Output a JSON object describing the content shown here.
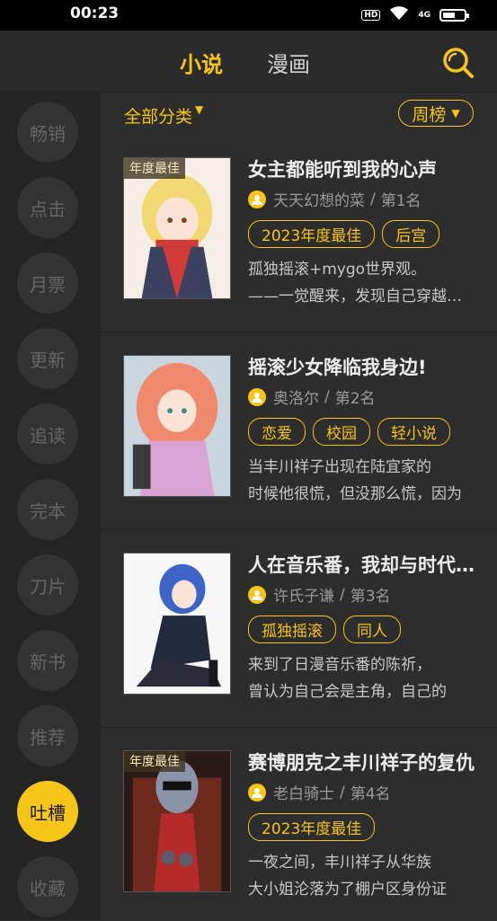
{
  "status_bar": {
    "time": "00:23",
    "hd": "HD",
    "network": "4G",
    "battery_level": 0.6
  },
  "header": {
    "tabs": [
      {
        "label": "小说",
        "active": true
      },
      {
        "label": "漫画",
        "active": false
      }
    ],
    "search_icon": "search-icon"
  },
  "sidebar": {
    "items": [
      {
        "label": "畅销"
      },
      {
        "label": "点击"
      },
      {
        "label": "月票"
      },
      {
        "label": "更新"
      },
      {
        "label": "追读"
      },
      {
        "label": "完本"
      },
      {
        "label": "刀片"
      },
      {
        "label": "新书"
      },
      {
        "label": "推荐"
      },
      {
        "label": "吐槽",
        "active": true
      },
      {
        "label": "收藏"
      }
    ]
  },
  "filter": {
    "category_label": "全部分类",
    "rank_label": "周榜"
  },
  "books": [
    {
      "badge": "年度最佳",
      "title": "女主都能听到我的心声",
      "author": "天天幻想的菜",
      "rank": "第1名",
      "tags": [
        "2023年度最佳",
        "后宫"
      ],
      "desc": [
        "孤独摇滚+mygo世界观。",
        "——一觉醒来，发现自己穿越到了"
      ]
    },
    {
      "badge": "",
      "title": "摇滚少女降临我身边!",
      "author": "奥洛尔",
      "rank": "第2名",
      "tags": [
        "恋爱",
        "校园",
        "轻小说"
      ],
      "desc": [
        "当丰川祥子出现在陆宜家的",
        "时候他很慌，但没那么慌，因为"
      ]
    },
    {
      "badge": "",
      "title": "人在音乐番，我却与时代脱节",
      "author": "许氏子谦",
      "rank": "第3名",
      "tags": [
        "孤独摇滚",
        "同人"
      ],
      "desc": [
        "来到了日漫音乐番的陈祈，",
        "曾认为自己会是主角，自己的"
      ]
    },
    {
      "badge": "年度最佳",
      "title": "赛博朋克之丰川祥子的复仇",
      "author": "老白骑士",
      "rank": "第4名",
      "tags": [
        "2023年度最佳"
      ],
      "desc": [
        "一夜之间，丰川祥子从华族",
        "大小姐沦落为了棚户区身份证"
      ]
    }
  ],
  "colors": {
    "accent": "#f5c518",
    "background": "#2d2d2d",
    "sidebar": "#242424"
  }
}
